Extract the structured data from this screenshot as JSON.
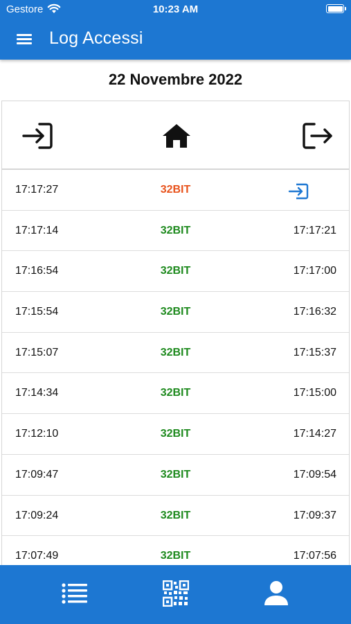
{
  "status": {
    "carrier": "Gestore",
    "time": "10:23 AM"
  },
  "header": {
    "title": "Log Accessi"
  },
  "date_label": "22 Novembre 2022",
  "columns": [
    "entrance-icon",
    "home-icon",
    "exit-icon"
  ],
  "colors": {
    "primary": "#1d77d2",
    "pending": "#e8531c",
    "ok": "#1e8a1e"
  },
  "rows": [
    {
      "in": "17:17:27",
      "site": "32BIT",
      "out": "",
      "status": "open"
    },
    {
      "in": "17:17:14",
      "site": "32BIT",
      "out": "17:17:21",
      "status": "closed"
    },
    {
      "in": "17:16:54",
      "site": "32BIT",
      "out": "17:17:00",
      "status": "closed"
    },
    {
      "in": "17:15:54",
      "site": "32BIT",
      "out": "17:16:32",
      "status": "closed"
    },
    {
      "in": "17:15:07",
      "site": "32BIT",
      "out": "17:15:37",
      "status": "closed"
    },
    {
      "in": "17:14:34",
      "site": "32BIT",
      "out": "17:15:00",
      "status": "closed"
    },
    {
      "in": "17:12:10",
      "site": "32BIT",
      "out": "17:14:27",
      "status": "closed"
    },
    {
      "in": "17:09:47",
      "site": "32BIT",
      "out": "17:09:54",
      "status": "closed"
    },
    {
      "in": "17:09:24",
      "site": "32BIT",
      "out": "17:09:37",
      "status": "closed"
    },
    {
      "in": "17:07:49",
      "site": "32BIT",
      "out": "17:07:56",
      "status": "closed"
    }
  ],
  "bottom_nav": [
    "list-icon",
    "qr-code-icon",
    "user-icon"
  ]
}
